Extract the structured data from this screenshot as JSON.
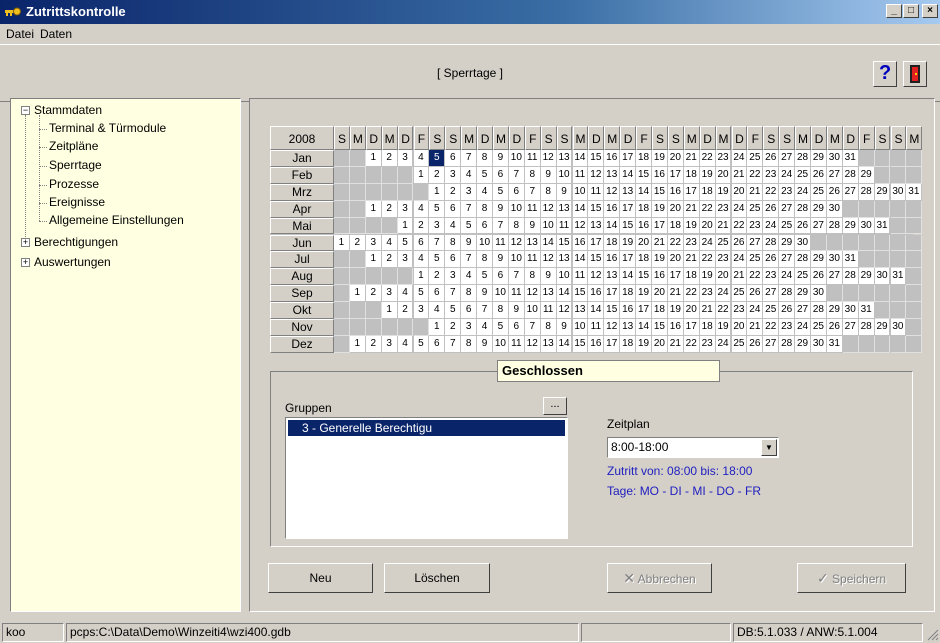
{
  "window": {
    "title": "Zutrittskontrolle",
    "min_label": "_",
    "max_label": "□",
    "close_label": "×"
  },
  "menu": {
    "items": [
      "Datei",
      "Daten"
    ]
  },
  "header": {
    "section_title": "[ Sperrtage ]",
    "help_label": "?"
  },
  "tree": {
    "nodes": [
      {
        "label": "Stammdaten",
        "expander": "−",
        "level": 0
      },
      {
        "label": "Terminal & Türmodule",
        "level": 1
      },
      {
        "label": "Zeitpläne",
        "level": 1
      },
      {
        "label": "Sperrtage",
        "level": 1
      },
      {
        "label": "Prozesse",
        "level": 1
      },
      {
        "label": "Ereignisse",
        "level": 1
      },
      {
        "label": "Allgemeine Einstellungen",
        "level": 1
      },
      {
        "label": "Berechtigungen",
        "expander": "+",
        "level": 0
      },
      {
        "label": "Auswertungen",
        "expander": "+",
        "level": 0
      }
    ]
  },
  "calendar": {
    "year": "2008",
    "weekday_headers": [
      "S",
      "M",
      "D",
      "M",
      "D",
      "F",
      "S",
      "S",
      "M",
      "D",
      "M",
      "D",
      "F",
      "S",
      "S",
      "M",
      "D",
      "M",
      "D",
      "F",
      "S",
      "S",
      "M",
      "D",
      "M",
      "D",
      "F",
      "S",
      "S",
      "M",
      "D",
      "M",
      "D",
      "F",
      "S",
      "S",
      "M"
    ],
    "months": [
      {
        "name": "Jan",
        "offset": 2,
        "days": 31
      },
      {
        "name": "Feb",
        "offset": 5,
        "days": 29
      },
      {
        "name": "Mrz",
        "offset": 6,
        "days": 31
      },
      {
        "name": "Apr",
        "offset": 2,
        "days": 30
      },
      {
        "name": "Mai",
        "offset": 4,
        "days": 31
      },
      {
        "name": "Jun",
        "offset": 0,
        "days": 30
      },
      {
        "name": "Jul",
        "offset": 2,
        "days": 31
      },
      {
        "name": "Aug",
        "offset": 5,
        "days": 31
      },
      {
        "name": "Sep",
        "offset": 1,
        "days": 30
      },
      {
        "name": "Okt",
        "offset": 3,
        "days": 31
      },
      {
        "name": "Nov",
        "offset": 6,
        "days": 30
      },
      {
        "name": "Dez",
        "offset": 1,
        "days": 31
      }
    ],
    "selected": {
      "month": "Jan",
      "day": 5
    }
  },
  "status_label": "Geschlossen",
  "groups": {
    "label": "Gruppen",
    "browse_label": "...",
    "items": [
      "3 - Generelle Berechtigu"
    ]
  },
  "zeitplan": {
    "label": "Zeitplan",
    "value": "8:00-18:00",
    "info_time": "Zutritt von: 08:00 bis: 18:00",
    "info_days": "Tage: MO - DI - MI - DO - FR"
  },
  "buttons": {
    "new": "Neu",
    "delete": "Löschen",
    "cancel": "Abbrechen",
    "save": "Speichern"
  },
  "statusbar": {
    "user": "koo",
    "db_path": "pcps:C:\\Data\\Demo\\Winzeiti4\\wzi400.gdb",
    "version": "DB:5.1.033 / ANW:5.1.004"
  },
  "colors": {
    "tree_bg": "#ffffe1",
    "selection": "#0a246a",
    "info_text": "#2020c0"
  }
}
